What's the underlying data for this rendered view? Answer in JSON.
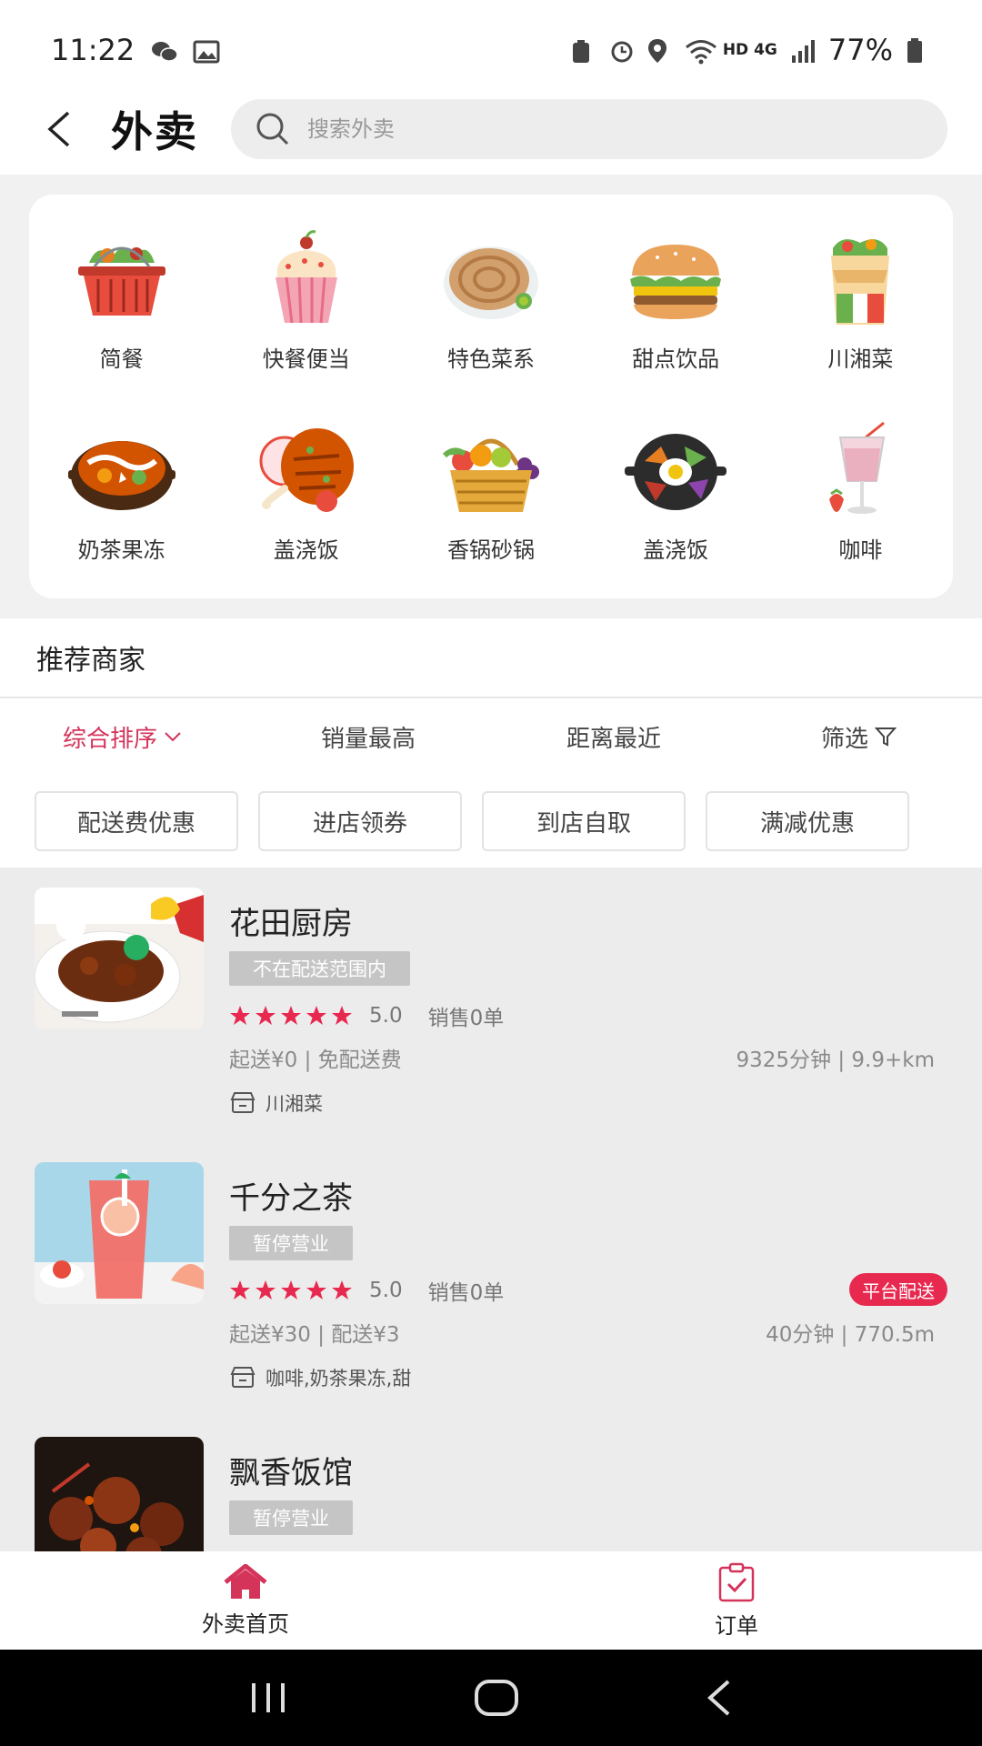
{
  "status_bar": {
    "time": "11:22",
    "network": "HD 4G",
    "battery": "77%"
  },
  "header": {
    "title": "外卖",
    "search_placeholder": "搜索外卖"
  },
  "categories": [
    {
      "label": "简餐",
      "icon": "basket-icon"
    },
    {
      "label": "快餐便当",
      "icon": "cupcake-icon"
    },
    {
      "label": "特色菜系",
      "icon": "pancake-icon"
    },
    {
      "label": "甜点饮品",
      "icon": "burger-icon"
    },
    {
      "label": "川湘菜",
      "icon": "wrap-icon"
    },
    {
      "label": "奶茶果冻",
      "icon": "hotpot-icon"
    },
    {
      "label": "盖浇饭",
      "icon": "chicken-icon"
    },
    {
      "label": "香锅砂锅",
      "icon": "fruit-basket-icon"
    },
    {
      "label": "盖浇饭",
      "icon": "bibimbap-icon"
    },
    {
      "label": "咖啡",
      "icon": "smoothie-icon"
    }
  ],
  "section": {
    "title": "推荐商家"
  },
  "sort_options": [
    "综合排序",
    "销量最高",
    "距离最近",
    "筛选"
  ],
  "filter_tags": [
    "配送费优惠",
    "进店领券",
    "到店自取",
    "满减优惠"
  ],
  "shops": [
    {
      "name": "花田厨房",
      "status": "不在配送范围内",
      "score": "5.0",
      "sales": "销售0单",
      "fee": "起送¥0 | 免配送费",
      "distance": "9325分钟 | 9.9+km",
      "category": "川湘菜",
      "badge": ""
    },
    {
      "name": "千分之茶",
      "status": "暂停营业",
      "score": "5.0",
      "sales": "销售0单",
      "fee": "起送¥30 | 配送¥3",
      "distance": "40分钟 | 770.5m",
      "category": "咖啡,奶茶果冻,甜",
      "badge": "平台配送"
    },
    {
      "name": "飘香饭馆",
      "status": "暂停营业",
      "score": "",
      "sales": "",
      "fee": "",
      "distance": "",
      "category": "",
      "badge": ""
    }
  ],
  "bottom_nav": [
    {
      "label": "外卖首页",
      "icon": "home-icon"
    },
    {
      "label": "订单",
      "icon": "order-clipboard-icon"
    }
  ],
  "colors": {
    "accent": "#d4335a",
    "badge": "#e8294f",
    "star": "#e8294f"
  }
}
